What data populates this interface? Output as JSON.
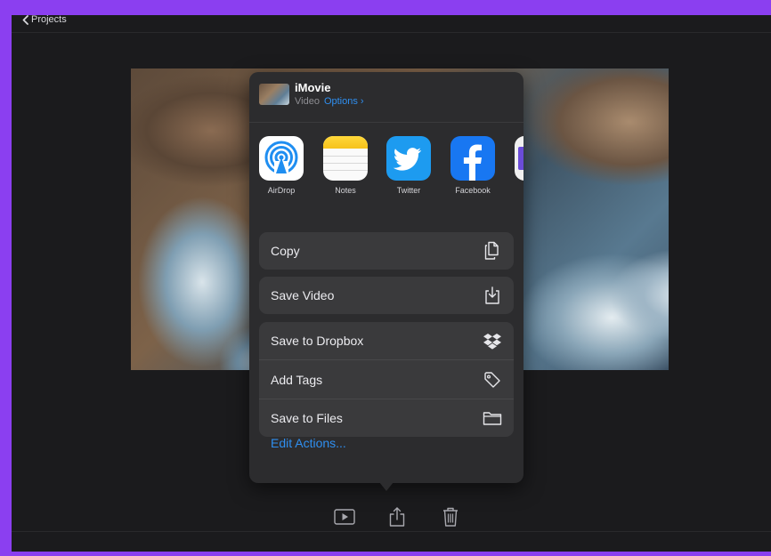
{
  "nav": {
    "back_label": "Projects"
  },
  "share_sheet": {
    "title": "iMovie",
    "subtitle": "Video",
    "options_label": "Options ›",
    "apps": [
      {
        "label": "AirDrop",
        "icon": "airdrop-icon"
      },
      {
        "label": "Notes",
        "icon": "notes-icon"
      },
      {
        "label": "Twitter",
        "icon": "twitter-icon"
      },
      {
        "label": "Facebook",
        "icon": "facebook-icon"
      }
    ],
    "actions_group1": [
      {
        "label": "Copy",
        "icon": "copy-icon"
      }
    ],
    "actions_group2": [
      {
        "label": "Save Video",
        "icon": "save-video-icon"
      }
    ],
    "actions_group3": [
      {
        "label": "Save to Dropbox",
        "icon": "dropbox-icon"
      },
      {
        "label": "Add Tags",
        "icon": "tag-icon"
      },
      {
        "label": "Save to Files",
        "icon": "folder-icon"
      }
    ],
    "edit_actions_label": "Edit Actions..."
  },
  "toolbar": {
    "buttons": [
      "play-icon",
      "share-icon",
      "trash-icon"
    ]
  },
  "colors": {
    "accent": "#2f8ff0",
    "frame": "#8b3ff0",
    "background": "#1b1b1d",
    "sheet": "#2c2c2e"
  }
}
